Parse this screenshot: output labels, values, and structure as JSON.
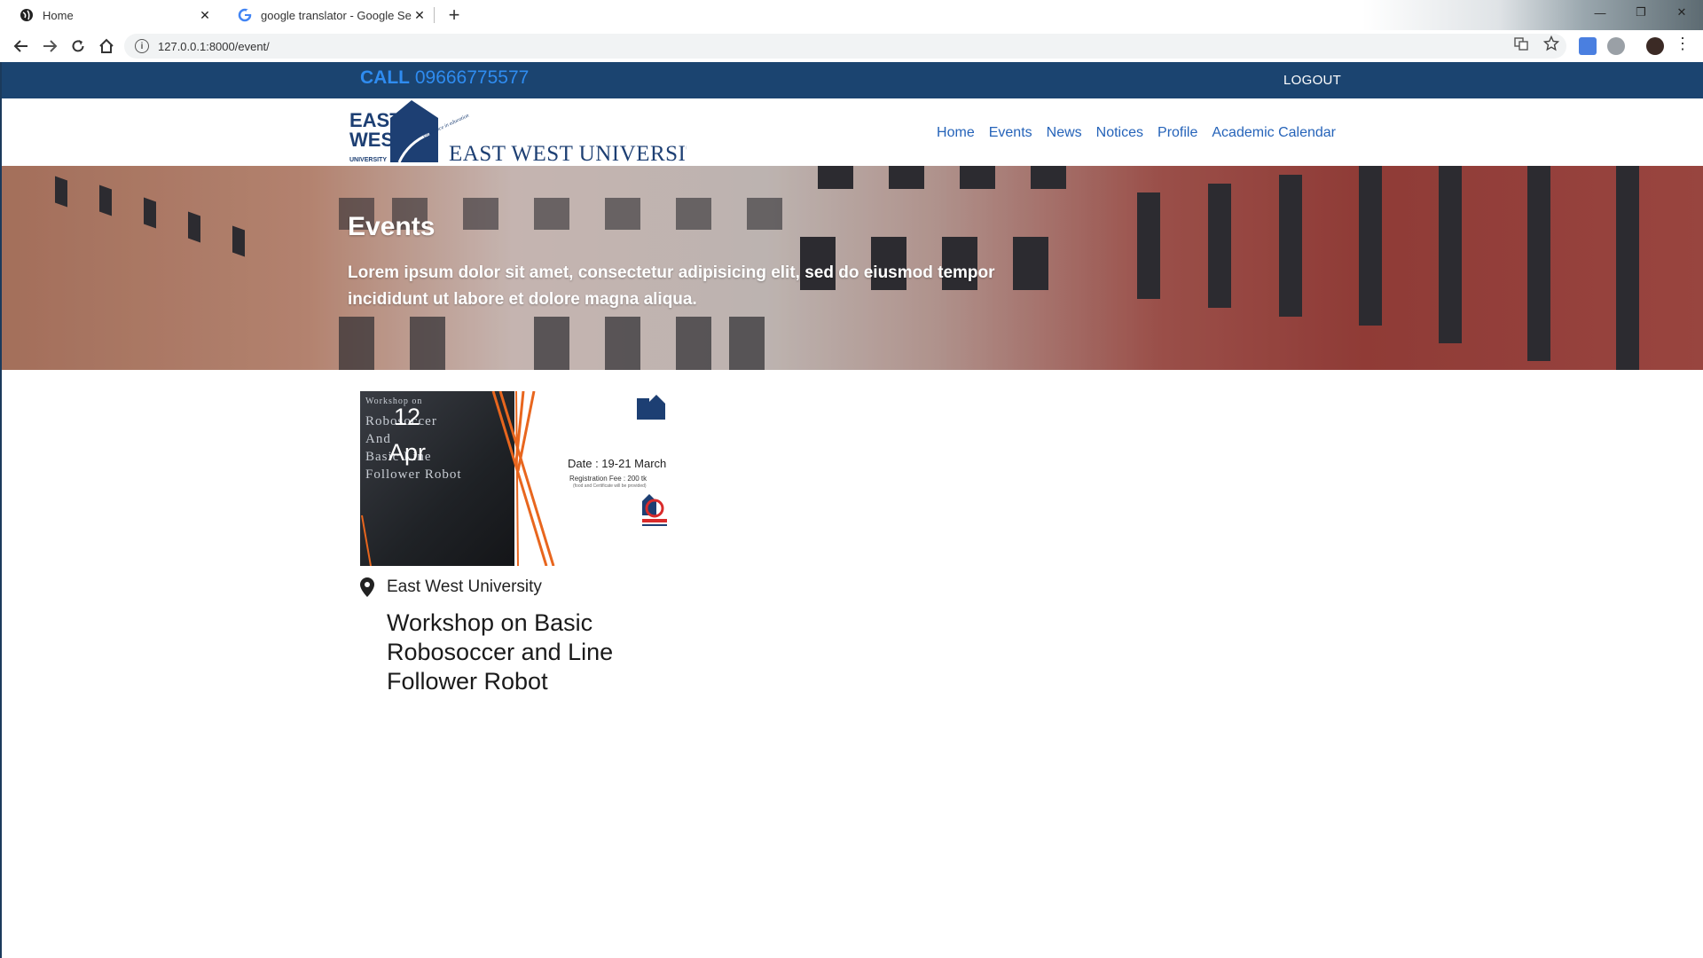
{
  "browser": {
    "tabs": [
      {
        "title": "Home",
        "icon": "globe-icon"
      },
      {
        "title": "google translator - Google Search",
        "icon": "google-icon"
      }
    ],
    "url": "127.0.0.1:8000/event/"
  },
  "topbar": {
    "call_label": "CALL",
    "phone": "09666775577",
    "logout": "LOGOUT"
  },
  "logo": {
    "mark_line1": "EAST",
    "mark_line2": "WEST",
    "mark_line3": "UNIVERSITY",
    "tagline": "excellence in education",
    "name": "EAST WEST UNIVERSITY"
  },
  "menu": {
    "items": [
      "Home",
      "Events",
      "News",
      "Notices",
      "Profile",
      "Academic Calendar"
    ]
  },
  "hero": {
    "title": "Events",
    "text": "Lorem ipsum dolor sit amet, consectetur adipisicing elit, sed do eiusmod tempor incididunt ut labore et dolore magna aliqua."
  },
  "event": {
    "day": "12",
    "month": "Apr",
    "location": "East West University",
    "title": "Workshop on Basic Robosoccer and Line Follower Robot",
    "poster": {
      "line1": "Workshop on",
      "line2": "Robosoccer",
      "line3": "And",
      "line4": "Basic Line",
      "line5": "Follower Robot",
      "date": "Date : 19-21 March",
      "fee": "Registration Fee : 200 tk",
      "note": "(food and Certificate will be provided)"
    }
  },
  "colors": {
    "topbar": "#1b4470",
    "accent": "#2f8cf0",
    "link": "#2563b9",
    "poster_orange": "#e8661e"
  }
}
